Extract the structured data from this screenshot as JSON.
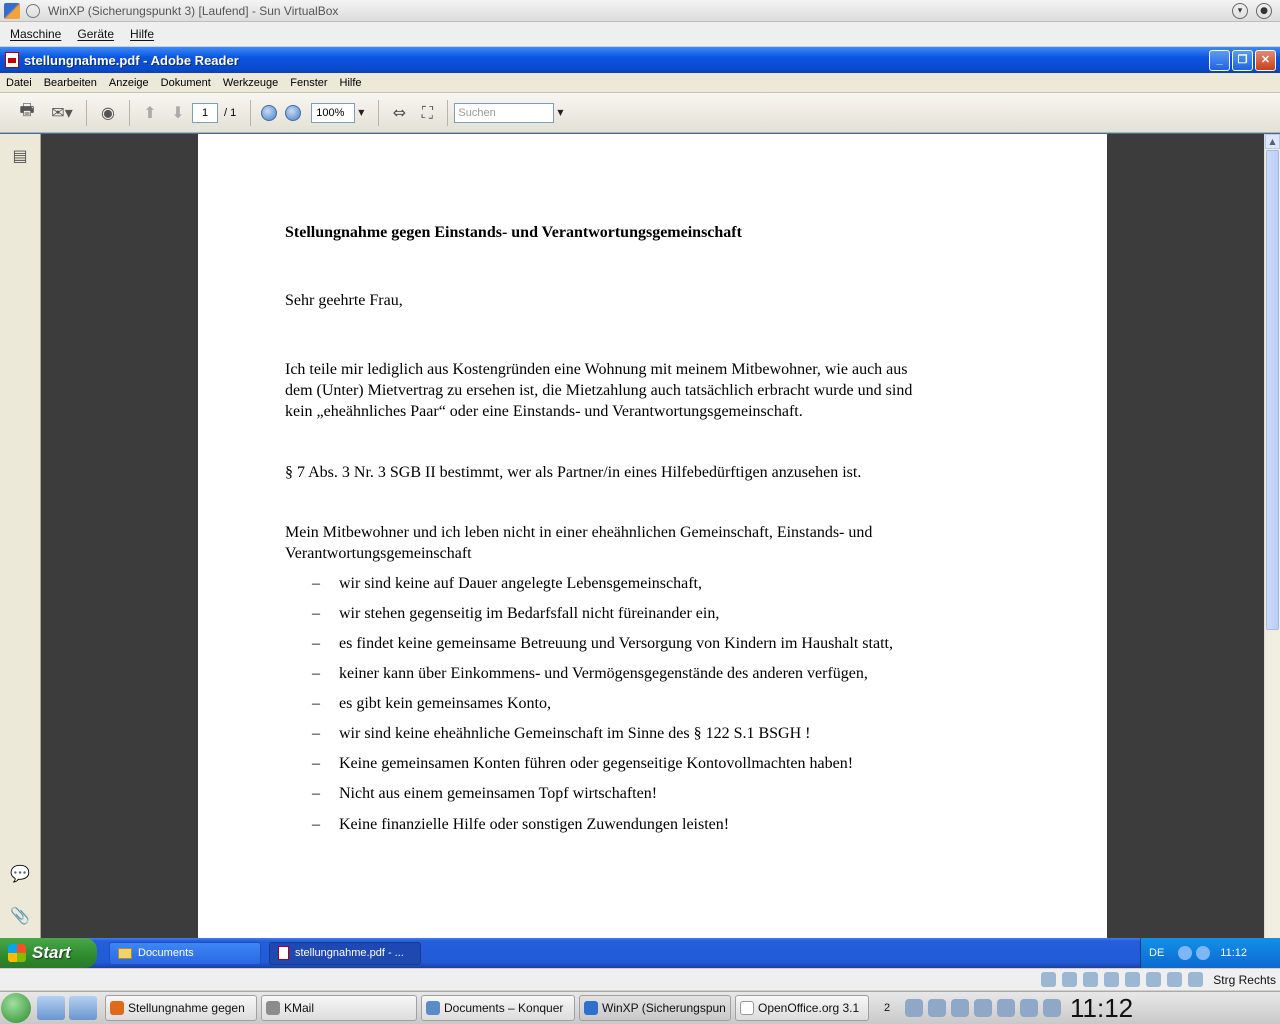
{
  "vbox": {
    "title": "WinXP (Sicherungspunkt 3) [Laufend] - Sun VirtualBox",
    "menu": [
      "Maschine",
      "Geräte",
      "Hilfe"
    ],
    "status_hostkey": "Strg Rechts"
  },
  "reader": {
    "title": "stellungnahme.pdf - Adobe Reader",
    "menu": [
      "Datei",
      "Bearbeiten",
      "Anzeige",
      "Dokument",
      "Werkzeuge",
      "Fenster",
      "Hilfe"
    ],
    "toolbar": {
      "page_current": "1",
      "page_total": "/ 1",
      "zoom": "100%",
      "search_placeholder": "Suchen"
    }
  },
  "document": {
    "heading": "Stellungnahme gegen Einstands- und Verantwortungsgemeinschaft",
    "salutation": "Sehr geehrte Frau,",
    "para1_lines": [
      "Ich teile mir lediglich aus Kostengründen eine Wohnung mit meinem Mitbewohner, wie auch aus",
      "dem (Unter) Mietvertrag zu ersehen ist, die Mietzahlung auch tatsächlich erbracht wurde und sind",
      "kein „eheähnliches Paar“ oder eine Einstands- und Verantwortungsgemeinschaft."
    ],
    "para2": "§ 7 Abs. 3 Nr. 3 SGB II bestimmt, wer als Partner/in eines Hilfebedürftigen anzusehen ist.",
    "para3_lines": [
      "Mein Mitbewohner und ich leben nicht in einer eheähnlichen Gemeinschaft, Einstands- und",
      "Verantwortungsgemeinschaft"
    ],
    "bullet_char": "–",
    "bullets": [
      "wir sind keine auf Dauer angelegte Lebensgemeinschaft,",
      "wir stehen gegenseitig im Bedarfsfall nicht füreinander ein,",
      "es findet keine gemeinsame Betreuung und Versorgung von Kindern im Haushalt statt,",
      "keiner kann über Einkommens- und Vermögensgegenstände des anderen verfügen,",
      "es gibt kein gemeinsames Konto,",
      "wir sind keine eheähnliche Gemeinschaft im Sinne des § 122 S.1 BSGH !",
      "Keine gemeinsamen Konten führen oder gegenseitige Kontovollmachten haben!",
      "Nicht aus einem gemeinsamen Topf wirtschaften!",
      "Keine finanzielle Hilfe oder sonstigen Zuwendungen leisten!"
    ]
  },
  "xp_taskbar": {
    "start": "Start",
    "tasks": [
      "Documents",
      "stellungnahme.pdf - ..."
    ],
    "lang": "DE",
    "clock": "11:12"
  },
  "kde_panel": {
    "tasks": [
      "Stellungnahme gegen",
      "KMail",
      "Documents – Konquer",
      "WinXP (Sicherungspun",
      "OpenOffice.org 3.1"
    ],
    "pager": "2",
    "clock": "11:12"
  }
}
